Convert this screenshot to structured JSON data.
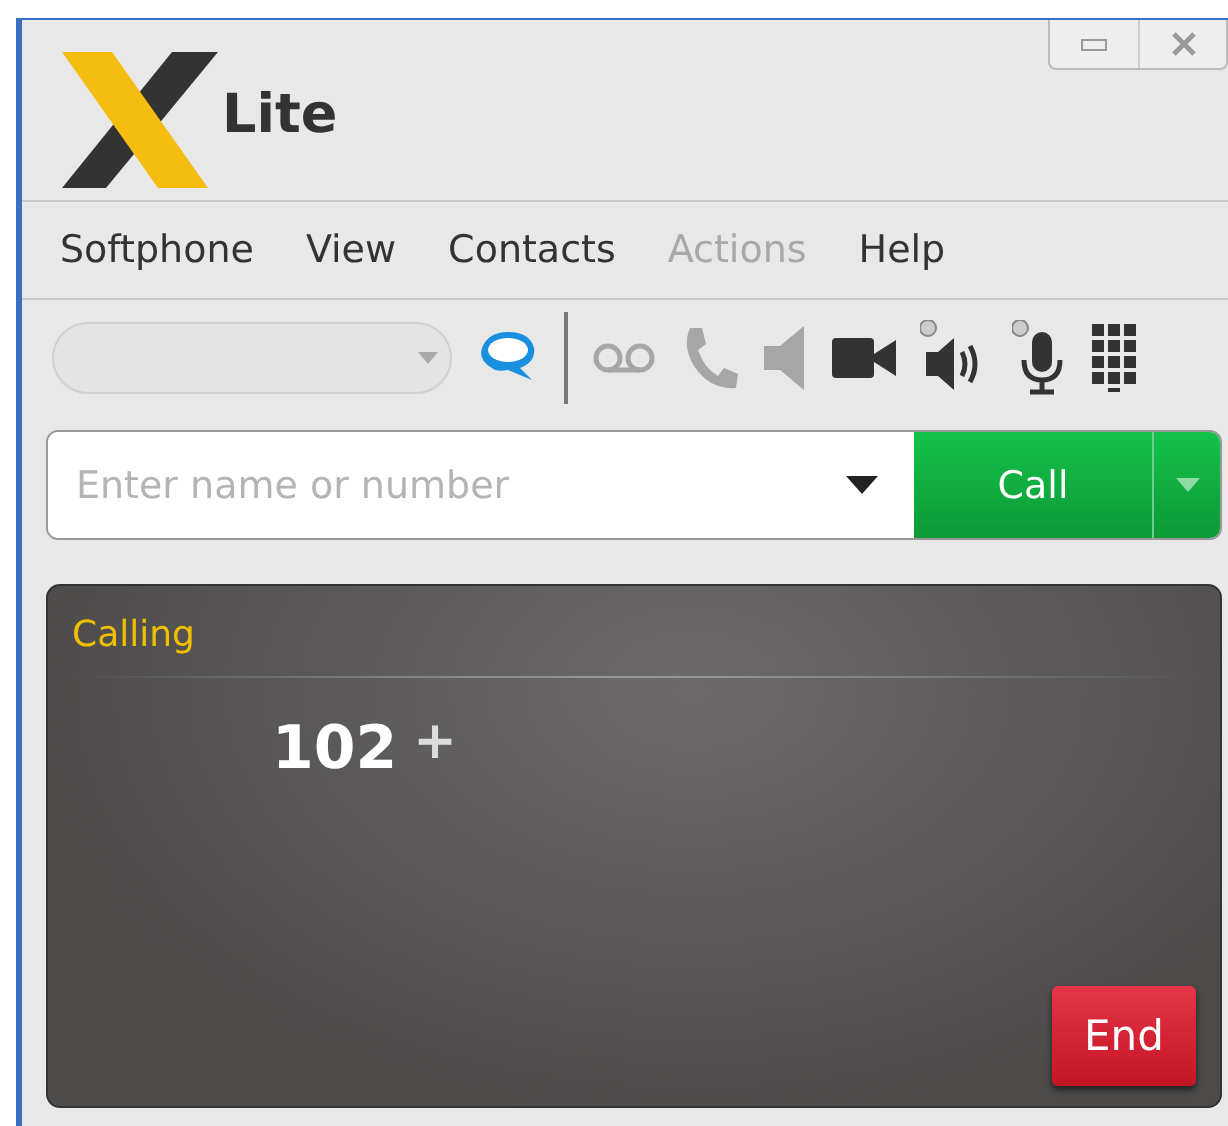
{
  "app": {
    "logo_text": "Lite"
  },
  "menu": [
    {
      "label": "Softphone",
      "disabled": false
    },
    {
      "label": "View",
      "disabled": false
    },
    {
      "label": "Contacts",
      "disabled": false
    },
    {
      "label": "Actions",
      "disabled": true
    },
    {
      "label": "Help",
      "disabled": false
    }
  ],
  "toolbar": [
    {
      "kind": "chat",
      "disabled": false
    },
    {
      "kind": "separator"
    },
    {
      "kind": "voicemail",
      "disabled": true
    },
    {
      "kind": "phone",
      "disabled": true
    },
    {
      "kind": "speaker",
      "disabled": true
    },
    {
      "kind": "video",
      "disabled": false
    },
    {
      "kind": "volume",
      "disabled": false
    },
    {
      "kind": "microphone",
      "disabled": false
    },
    {
      "kind": "keypad",
      "disabled": false
    }
  ],
  "dial": {
    "placeholder": "Enter name or number",
    "call_button": "Call"
  },
  "call_panel": {
    "status": "Calling",
    "number": "102",
    "add": "+",
    "end_button": "End"
  }
}
